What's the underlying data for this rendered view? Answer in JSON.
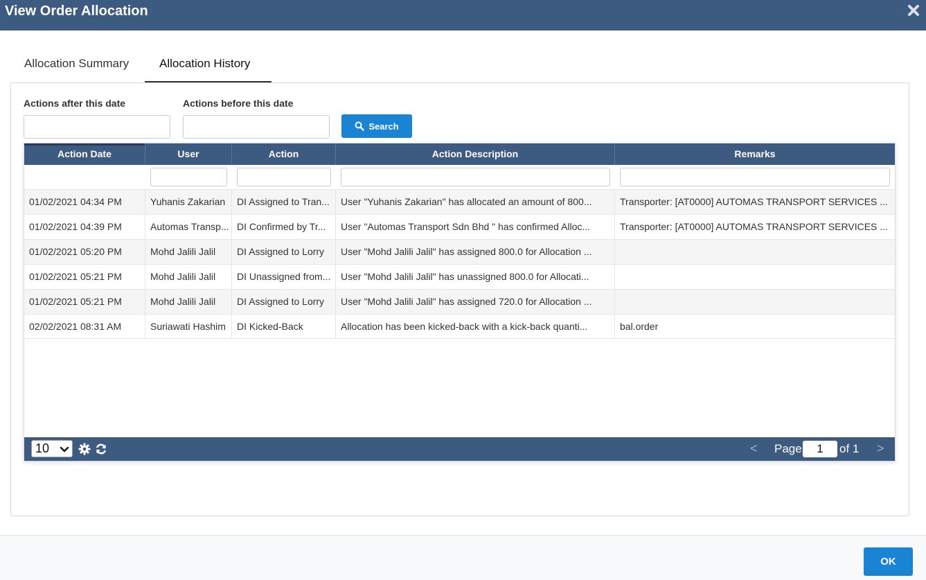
{
  "window": {
    "title": "View Order Allocation"
  },
  "tabs": [
    {
      "label": "Allocation Summary",
      "active": false
    },
    {
      "label": "Allocation History",
      "active": true
    }
  ],
  "filters": {
    "after_label": "Actions after this date",
    "after_value": "",
    "before_label": "Actions before this date",
    "before_value": "",
    "search_label": "Search"
  },
  "grid": {
    "columns": [
      "Action Date",
      "User",
      "Action",
      "Action Description",
      "Remarks"
    ],
    "rows": [
      [
        "01/02/2021 04:34 PM",
        "Yuhanis Zakarian",
        "DI Assigned to Tran...",
        "User \"Yuhanis Zakarian\" has allocated an amount of 800...",
        "Transporter: [AT0000] AUTOMAS TRANSPORT SERVICES ..."
      ],
      [
        "01/02/2021 04:39 PM",
        "Automas Transp...",
        "DI Confirmed by Tr...",
        "User \"Automas Transport Sdn Bhd \" has confirmed Alloc...",
        "Transporter: [AT0000] AUTOMAS TRANSPORT SERVICES ..."
      ],
      [
        "01/02/2021 05:20 PM",
        "Mohd Jalili Jalil",
        "DI Assigned to Lorry",
        "User \"Mohd Jalili Jalil\" has assigned 800.0 for Allocation ...",
        ""
      ],
      [
        "01/02/2021 05:21 PM",
        "Mohd Jalili Jalil",
        "DI Unassigned from...",
        "User \"Mohd Jalili Jalil\" has unassigned 800.0 for Allocati...",
        ""
      ],
      [
        "01/02/2021 05:21 PM",
        "Mohd Jalili Jalil",
        "DI Assigned to Lorry",
        "User \"Mohd Jalili Jalil\" has assigned 720.0 for Allocation ...",
        ""
      ],
      [
        "02/02/2021 08:31 AM",
        "Suriawati Hashim",
        "DI Kicked-Back",
        "Allocation has been kicked-back with a kick-back quanti...",
        "bal.order"
      ]
    ]
  },
  "pager": {
    "page_size": "10",
    "prev": "<",
    "page_label": "Page",
    "page_value": "1",
    "of_label": "of 1",
    "next": ">"
  },
  "footer": {
    "ok_label": "OK"
  },
  "colors": {
    "header": "#3d5a80",
    "primary": "#1a84d4"
  },
  "icons": [
    "close-icon",
    "search-icon",
    "chevron-down-icon",
    "gear-icon",
    "refresh-icon"
  ]
}
